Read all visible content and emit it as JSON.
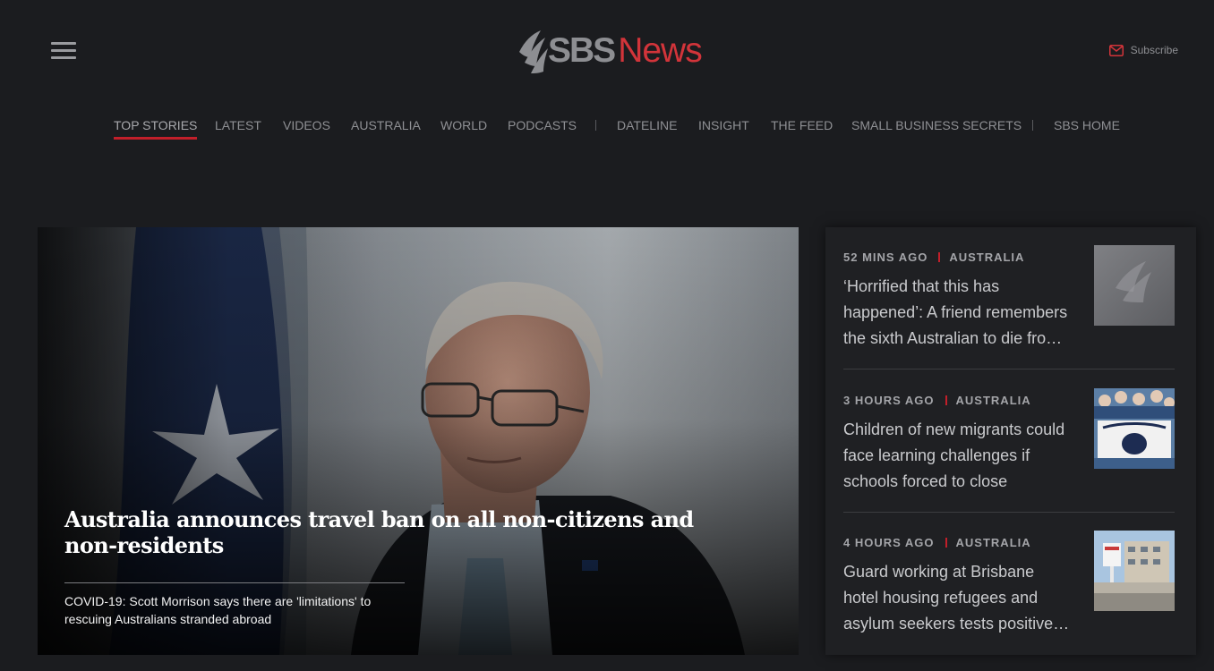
{
  "header": {
    "brand_sbs": "SBS",
    "brand_news": "News",
    "subscribe_label": "Subscribe",
    "menu_icon": "hamburger-icon",
    "subscribe_icon": "mail-icon"
  },
  "nav": {
    "items": [
      {
        "label": "TOP STORIES",
        "active": true
      },
      {
        "label": "LATEST"
      },
      {
        "label": "VIDEOS"
      },
      {
        "label": "AUSTRALIA"
      },
      {
        "label": "WORLD"
      },
      {
        "label": "PODCASTS"
      },
      {
        "label": "DATELINE"
      },
      {
        "label": "INSIGHT"
      },
      {
        "label": "THE FEED"
      },
      {
        "label": "SMALL BUSINESS SECRETS"
      },
      {
        "label": "SBS HOME"
      }
    ]
  },
  "hero": {
    "headline": "Australia announces travel ban on all non-citizens and non-residents",
    "subheadline": "COVID-19: Scott Morrison says there are 'limitations' to rescuing Australians stranded abroad"
  },
  "sidebar": {
    "stories": [
      {
        "time": "52 MINS AGO",
        "category": "AUSTRALIA",
        "title": "‘Horrified that this has happened’: A friend remembers the sixth Australian to die fro…"
      },
      {
        "time": "3 HOURS AGO",
        "category": "AUSTRALIA",
        "title": "Children of new migrants could face learning challenges if schools forced to close"
      },
      {
        "time": "4 HOURS AGO",
        "category": "AUSTRALIA",
        "title": "Guard working at Brisbane hotel housing refugees and asylum seekers tests positive…"
      }
    ]
  },
  "colors": {
    "background": "#1b1c1f",
    "accent_red": "#c21f2a",
    "brand_red": "#d2343a"
  }
}
